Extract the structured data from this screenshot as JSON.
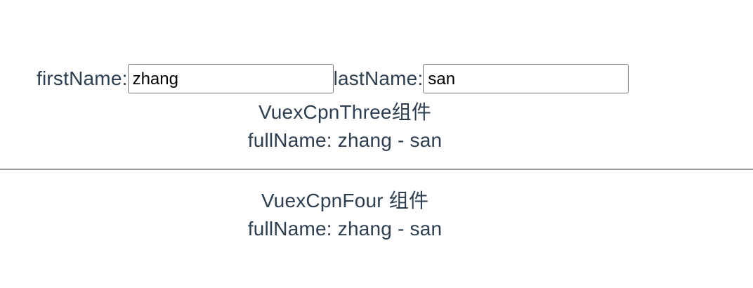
{
  "component_three": {
    "first_name_label": "firstName:",
    "first_name_value": "zhang",
    "last_name_label": "lastName:",
    "last_name_value": "san",
    "title": "VuexCpnThree组件",
    "full_name_text": "fullName: zhang - san"
  },
  "component_four": {
    "title": "VuexCpnFour 组件",
    "full_name_text": "fullName: zhang - san"
  },
  "colors": {
    "text": "#2c3e50",
    "divider": "#9e9e9e",
    "input_border": "#767676"
  }
}
